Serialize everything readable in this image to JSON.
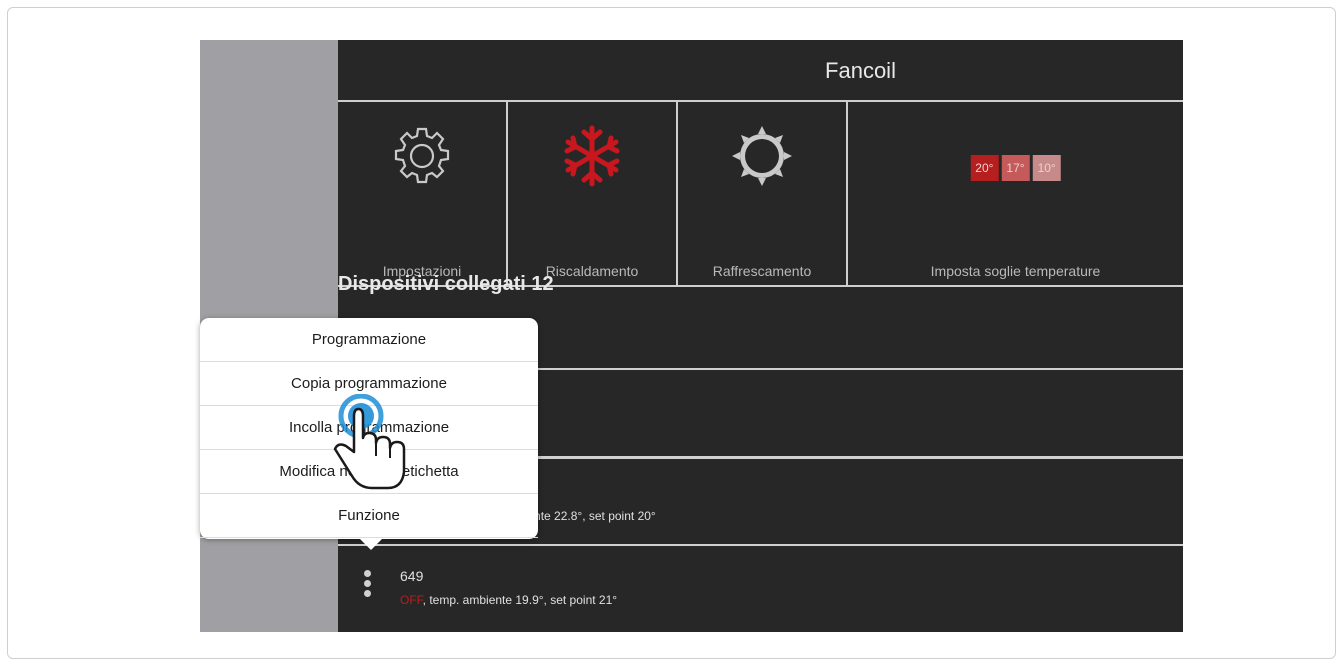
{
  "app": {
    "title": "Fancoil",
    "tiles": [
      {
        "label": "Impostazioni",
        "icon": "gear-icon"
      },
      {
        "label": "Riscaldamento",
        "icon": "snowflake-icon"
      },
      {
        "label": "Raffrescamento",
        "icon": "sun-icon"
      },
      {
        "label": "Imposta soglie temperature",
        "thresholds": [
          "20°",
          "17°",
          "10°"
        ]
      }
    ],
    "devices_heading": "Dispositivi collegati 12",
    "rows": [
      {
        "status": "temp. ambiente 22.8°, set point 20°"
      },
      {
        "name": "649",
        "state": "OFF",
        "status": ", temp. ambiente 19.9°, set point 21°"
      }
    ]
  },
  "menu": {
    "items": [
      "Programmazione",
      "Copia programmazione",
      "Incolla programmazione",
      "Modifica nome ed etichetta",
      "Funzione"
    ]
  },
  "colors": {
    "accent_red": "#c8171f",
    "threshold_colors": [
      "#b51f1f",
      "#c45a5a",
      "#c68a8a"
    ],
    "touch_blue": "#1e8fd6"
  }
}
